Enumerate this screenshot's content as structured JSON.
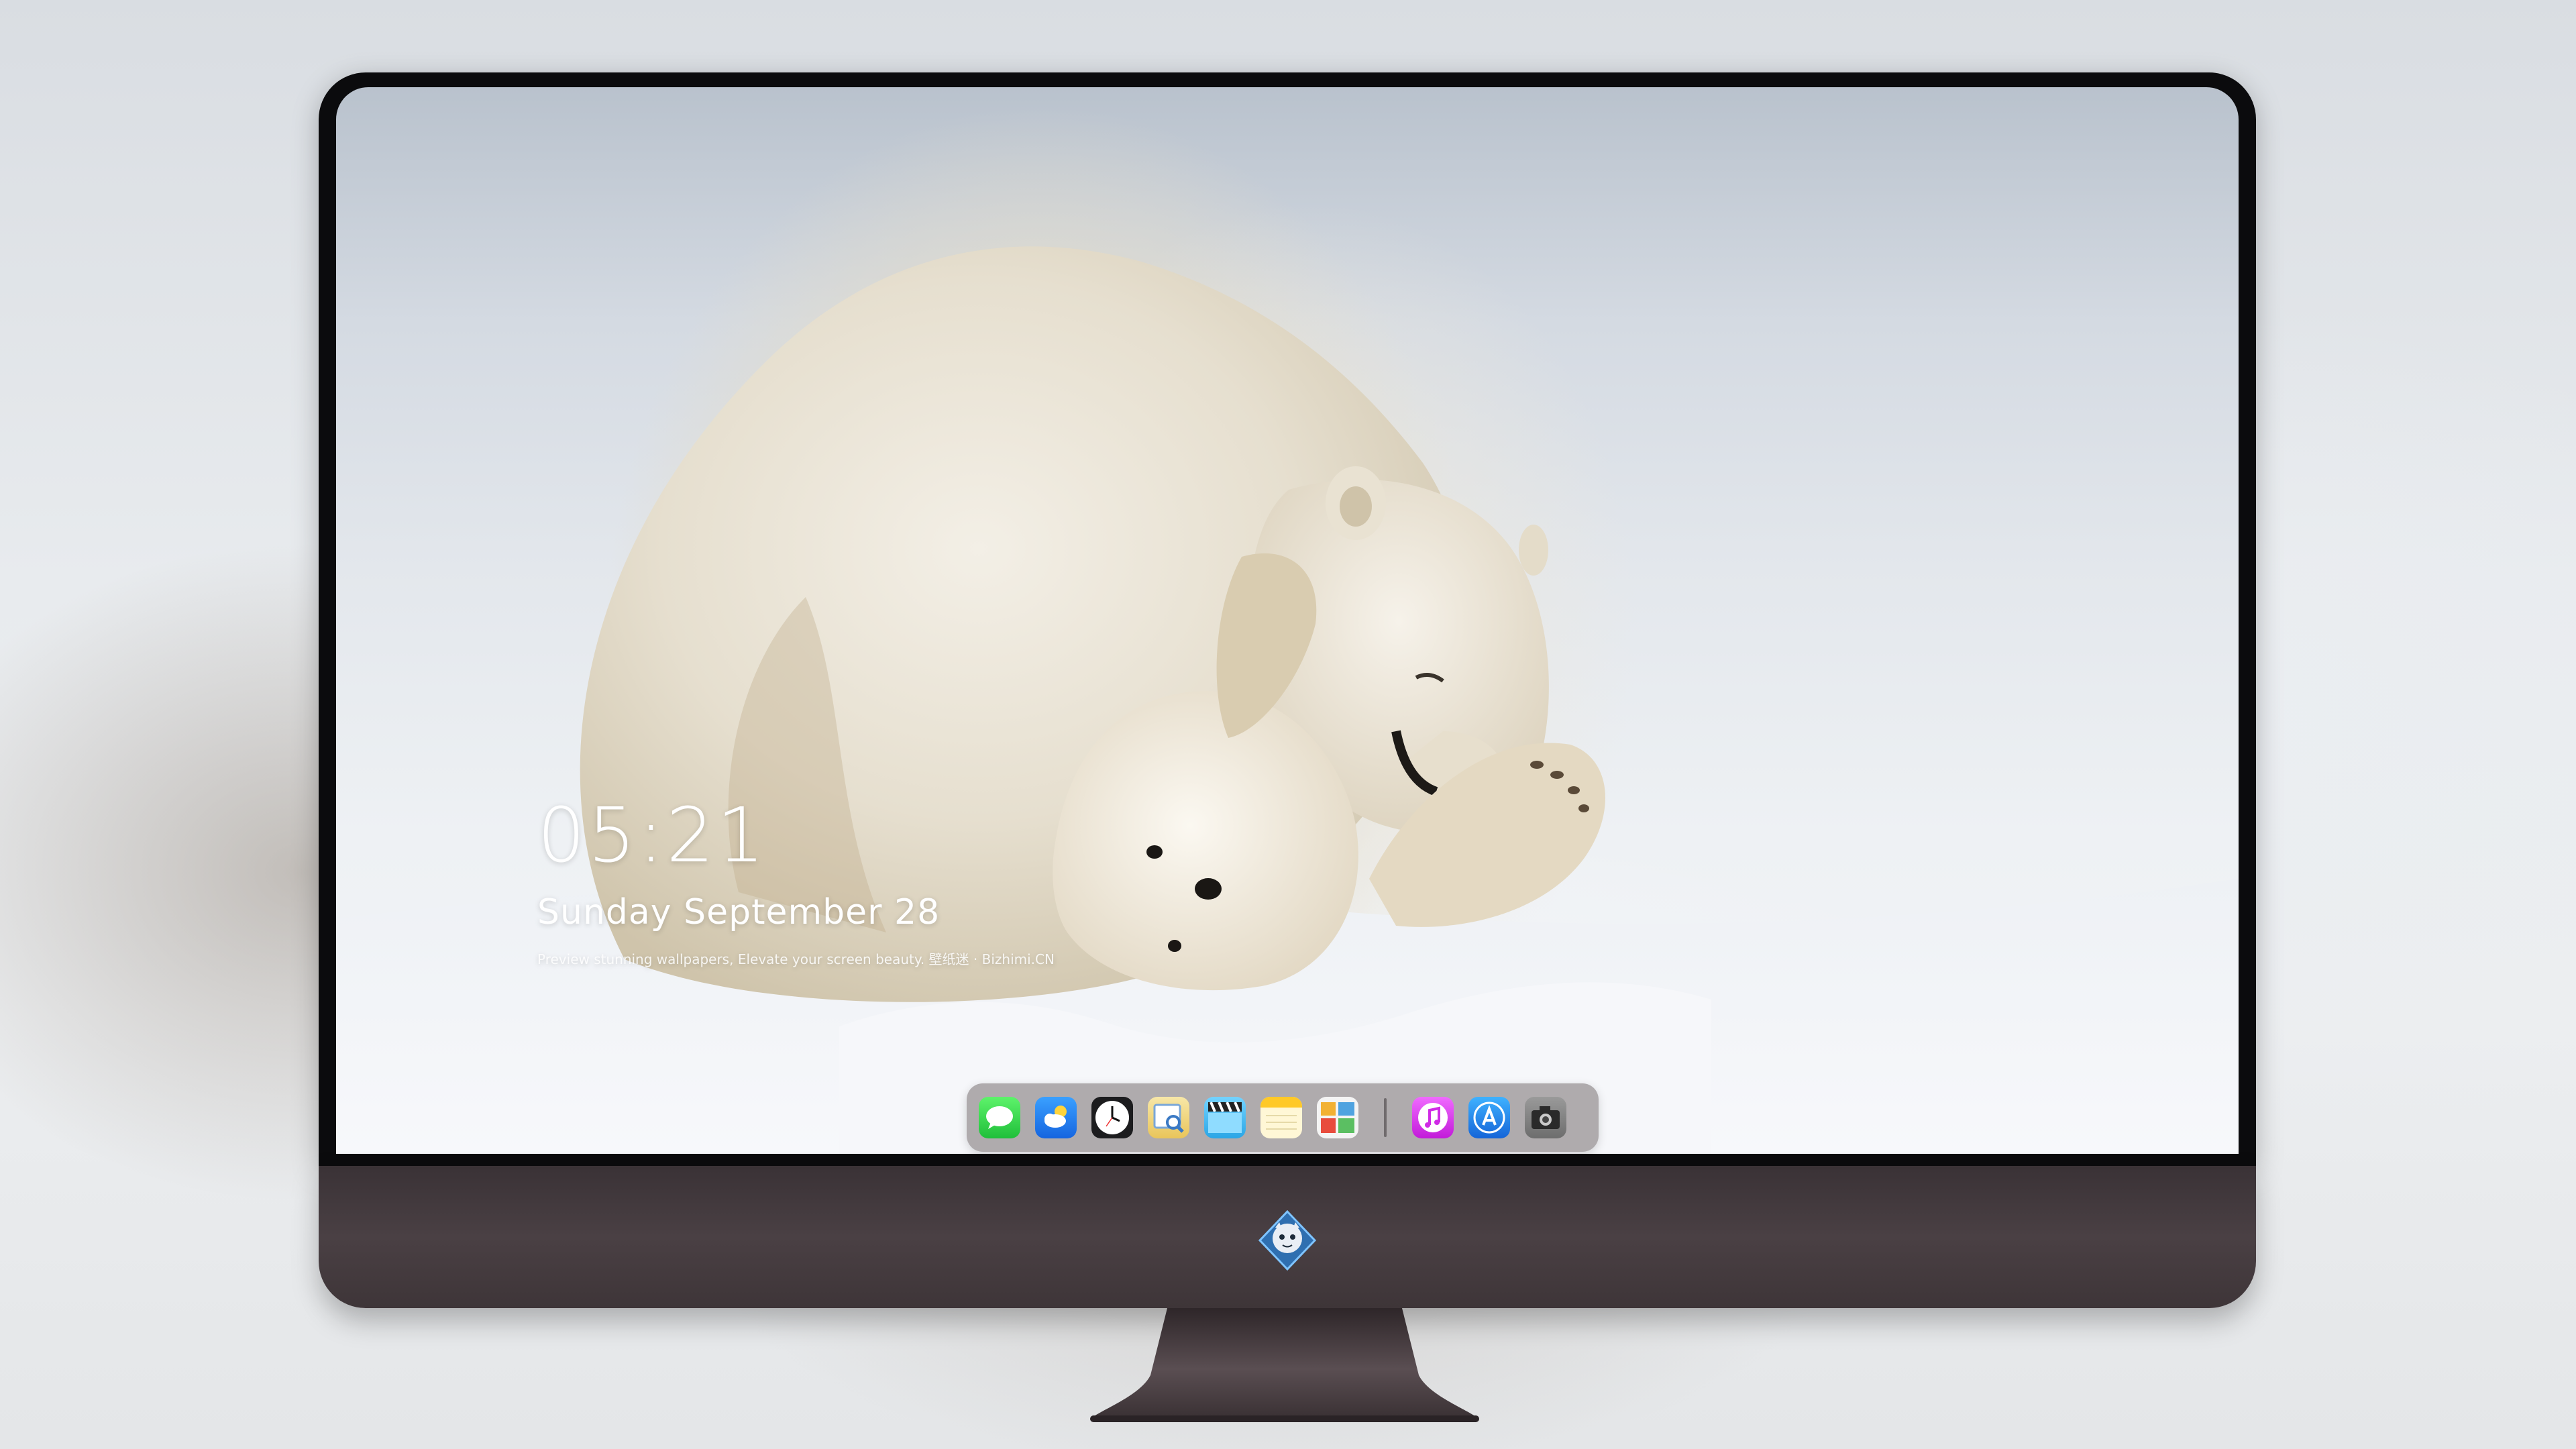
{
  "lockscreen": {
    "time": "05:21",
    "date": "Sunday September  28",
    "tagline": "Preview stunning wallpapers, Elevate your screen beauty. 壁纸迷 · Bizhimi.CN"
  },
  "dock": {
    "items": [
      {
        "name": "messages-icon",
        "color": "#2ecc40"
      },
      {
        "name": "weather-icon",
        "color": "#2f8ff0"
      },
      {
        "name": "clock-icon",
        "color": "#ffffff"
      },
      {
        "name": "preview-icon",
        "color": "#f2c94c"
      },
      {
        "name": "clapperboard-icon",
        "color": "#5ac8fa"
      },
      {
        "name": "notes-icon",
        "color": "#ffd54f"
      },
      {
        "name": "photo-gallery-icon",
        "color": "#f5f5f5"
      },
      {
        "name": "music-icon",
        "color": "#e040fb"
      },
      {
        "name": "app-store-icon",
        "color": "#1e88e5"
      },
      {
        "name": "camera-icon",
        "color": "#8a8a8a"
      }
    ]
  }
}
